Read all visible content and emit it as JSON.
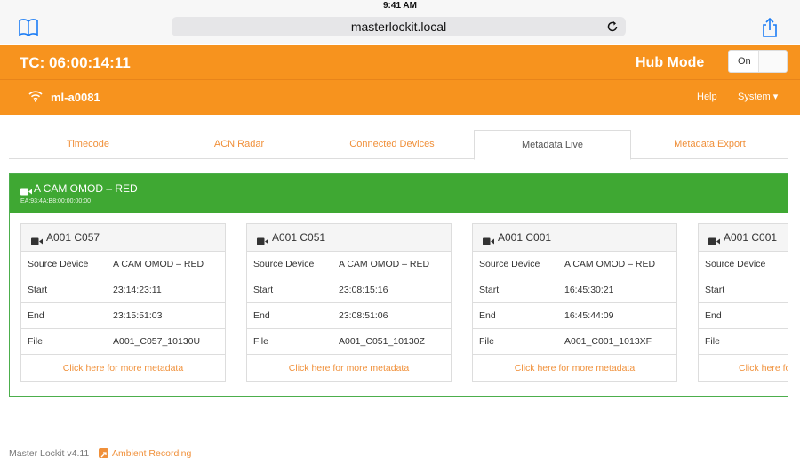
{
  "status_bar": {
    "time": "9:41 AM"
  },
  "browser": {
    "url": "masterlockit.local"
  },
  "header": {
    "timecode": "TC: 06:00:14:11",
    "hub_mode_label": "Hub Mode",
    "hub_mode_toggle": "On"
  },
  "nav": {
    "device_name": "ml-a0081",
    "help": "Help",
    "system": "System ▾"
  },
  "tabs": [
    {
      "label": "Timecode"
    },
    {
      "label": "ACN Radar"
    },
    {
      "label": "Connected Devices"
    },
    {
      "label": "Metadata Live",
      "active": true
    },
    {
      "label": "Metadata Export"
    }
  ],
  "camera": {
    "name": "A CAM OMOD – RED",
    "mac": "EA:93:4A:B8:00:00:00:00"
  },
  "clips": [
    {
      "title": "A001 C057",
      "rows": [
        {
          "key": "Source Device",
          "value": "A CAM OMOD – RED"
        },
        {
          "key": "Start",
          "value": "23:14:23:11"
        },
        {
          "key": "End",
          "value": "23:15:51:03"
        },
        {
          "key": "File",
          "value": "A001_C057_10130U"
        }
      ],
      "more": "Click here for more metadata"
    },
    {
      "title": "A001 C051",
      "rows": [
        {
          "key": "Source Device",
          "value": "A CAM OMOD – RED"
        },
        {
          "key": "Start",
          "value": "23:08:15:16"
        },
        {
          "key": "End",
          "value": "23:08:51:06"
        },
        {
          "key": "File",
          "value": "A001_C051_10130Z"
        }
      ],
      "more": "Click here for more metadata"
    },
    {
      "title": "A001 C001",
      "rows": [
        {
          "key": "Source Device",
          "value": "A CAM OMOD – RED"
        },
        {
          "key": "Start",
          "value": "16:45:30:21"
        },
        {
          "key": "End",
          "value": "16:45:44:09"
        },
        {
          "key": "File",
          "value": "A001_C001_1013XF"
        }
      ],
      "more": "Click here for more metadata"
    },
    {
      "title": "A001 C001",
      "rows": [
        {
          "key": "Source Device",
          "value": ""
        },
        {
          "key": "Start",
          "value": ""
        },
        {
          "key": "End",
          "value": ""
        },
        {
          "key": "File",
          "value": ""
        }
      ],
      "more": "Click here fo"
    }
  ],
  "footer": {
    "version": "Master Lockit v4.11",
    "recording_link": "Ambient Recording"
  },
  "colors": {
    "brand_orange": "#f7931e",
    "live_green": "#3fa833",
    "link_orange": "#f0903a"
  },
  "icons": [
    "bookmarks-icon",
    "reload-icon",
    "share-icon",
    "wifi-icon",
    "video-camera-icon",
    "recording-icon"
  ]
}
